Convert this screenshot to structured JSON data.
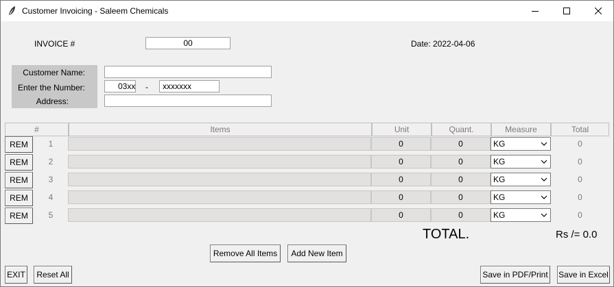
{
  "window": {
    "title": "Customer Invoicing - Saleem Chemicals"
  },
  "invoice": {
    "label": "INVOICE #",
    "number": "00",
    "date_label": "Date: 2022-04-06"
  },
  "customer": {
    "name_label": "Customer Name:",
    "number_label": "Enter the Number:",
    "address_label": "Address:",
    "name_value": "",
    "phone_prefix": "03xx",
    "phone_sep": "-",
    "phone_rest": "xxxxxxx",
    "address_value": ""
  },
  "table": {
    "headers": [
      "#",
      "Items",
      "Unit",
      "Quant.",
      "Measure",
      "Total"
    ],
    "rows": [
      {
        "rem": "REM",
        "index": "1",
        "item": "",
        "unit": "0",
        "quant": "0",
        "measure": "KG",
        "total": "0"
      },
      {
        "rem": "REM",
        "index": "2",
        "item": "",
        "unit": "0",
        "quant": "0",
        "measure": "KG",
        "total": "0"
      },
      {
        "rem": "REM",
        "index": "3",
        "item": "",
        "unit": "0",
        "quant": "0",
        "measure": "KG",
        "total": "0"
      },
      {
        "rem": "REM",
        "index": "4",
        "item": "",
        "unit": "0",
        "quant": "0",
        "measure": "KG",
        "total": "0"
      },
      {
        "rem": "REM",
        "index": "5",
        "item": "",
        "unit": "0",
        "quant": "0",
        "measure": "KG",
        "total": "0"
      }
    ]
  },
  "summary": {
    "total_label": "TOTAL.",
    "total_value": "Rs /= 0.0"
  },
  "buttons": {
    "remove_all": "Remove All Items",
    "add_new": "Add New Item",
    "exit": "EXIT",
    "reset_all": "Reset All",
    "save_pdf": "Save in PDF/Print",
    "save_excel": "Save in Excel"
  }
}
